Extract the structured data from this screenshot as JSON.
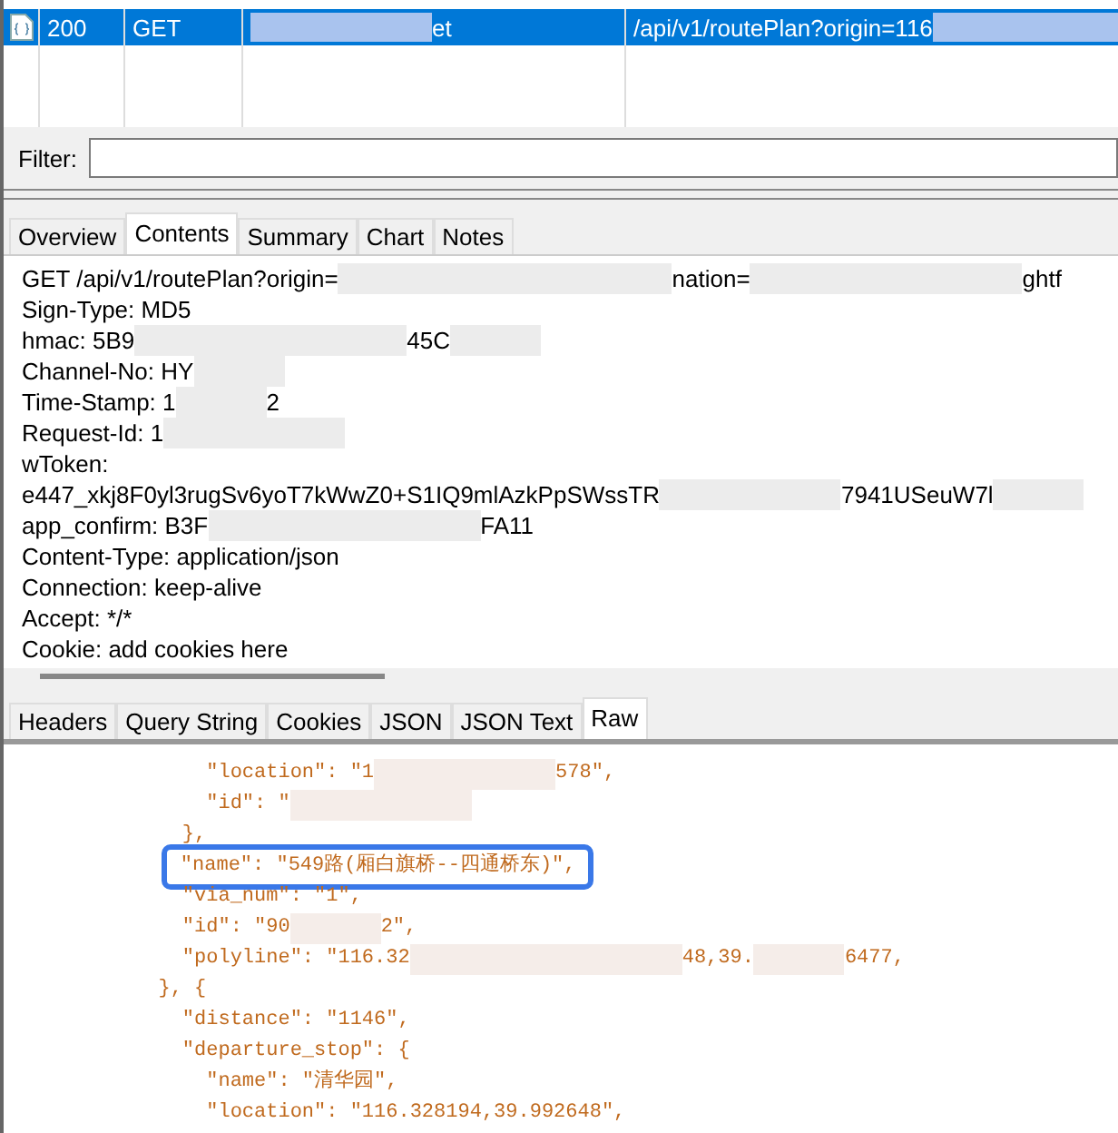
{
  "requests": [
    {
      "selected": true,
      "status": "200",
      "method": "GET",
      "host": [
        {
          "kind": "blur_medium"
        },
        {
          "kind": "text",
          "text": "et"
        }
      ],
      "path": [
        {
          "kind": "text",
          "text": "/api/v1/routePlan?origin=116"
        },
        {
          "kind": "blur_long"
        }
      ]
    }
  ],
  "filter": {
    "label": "Filter:"
  },
  "view_tabs": [
    {
      "label": "Overview",
      "selected": false
    },
    {
      "label": "Contents",
      "selected": true
    },
    {
      "label": "Summary",
      "selected": false
    },
    {
      "label": "Chart",
      "selected": false
    },
    {
      "label": "Notes",
      "selected": false
    }
  ],
  "request_lines": [
    [
      {
        "kind": "text",
        "text": "GET /api/v1/routePlan?origin="
      },
      {
        "kind": "blur_xlong"
      },
      {
        "kind": "text",
        "text": "nation="
      },
      {
        "kind": "blur_long"
      },
      {
        "kind": "text",
        "text": "ghtf"
      }
    ],
    [
      {
        "kind": "text",
        "text": "Sign-Type: MD5"
      }
    ],
    [
      {
        "kind": "text",
        "text": "hmac: 5B9"
      },
      {
        "kind": "blur_long"
      },
      {
        "kind": "text",
        "text": "45C"
      },
      {
        "kind": "blur_short"
      }
    ],
    [
      {
        "kind": "text",
        "text": "Channel-No: HY"
      },
      {
        "kind": "blur_short"
      }
    ],
    [
      {
        "kind": "text",
        "text": "Time-Stamp: 1"
      },
      {
        "kind": "blur_short"
      },
      {
        "kind": "text",
        "text": "2"
      }
    ],
    [
      {
        "kind": "text",
        "text": "Request-Id: 1"
      },
      {
        "kind": "blur_medium"
      }
    ],
    [
      {
        "kind": "text",
        "text": "wToken:"
      }
    ],
    [
      {
        "kind": "text",
        "text": "e447_xkj8F0yl3rugSv6yoT7kWwZ0+S1IQ9mlAzkPpSWssTR"
      },
      {
        "kind": "blur_medium"
      },
      {
        "kind": "text",
        "text": "7941USeuW7l"
      },
      {
        "kind": "blur_short"
      }
    ],
    [
      {
        "kind": "text",
        "text": "app_confirm: B3F"
      },
      {
        "kind": "blur_long"
      },
      {
        "kind": "text",
        "text": "FA11"
      }
    ],
    [
      {
        "kind": "text",
        "text": "Content-Type: application/json"
      }
    ],
    [
      {
        "kind": "text",
        "text": "Connection: keep-alive"
      }
    ],
    [
      {
        "kind": "text",
        "text": "Accept: */*"
      }
    ],
    [
      {
        "kind": "text",
        "text": "Cookie: add cookies here"
      }
    ]
  ],
  "body_tabs": [
    {
      "label": "Headers",
      "selected": false
    },
    {
      "label": "Query String",
      "selected": false
    },
    {
      "label": "Cookies",
      "selected": false
    },
    {
      "label": "JSON",
      "selected": false
    },
    {
      "label": "JSON Text",
      "selected": false
    },
    {
      "label": "Raw",
      "selected": true
    }
  ],
  "response_lines": [
    {
      "highlighted": false,
      "segments": [
        {
          "kind": "text",
          "text": "                \"location\": \"1"
        },
        {
          "kind": "blur_medium"
        },
        {
          "kind": "text",
          "text": "578\","
        }
      ]
    },
    {
      "highlighted": false,
      "segments": [
        {
          "kind": "text",
          "text": "                \"id\": \""
        },
        {
          "kind": "blur_medium"
        }
      ]
    },
    {
      "highlighted": false,
      "segments": [
        {
          "kind": "text",
          "text": "              },"
        }
      ]
    },
    {
      "highlighted": true,
      "segments": [
        {
          "kind": "text",
          "text": "              \"name\": \"549路(厢白旗桥--四通桥东)\","
        }
      ]
    },
    {
      "highlighted": false,
      "segments": [
        {
          "kind": "text",
          "text": "              \"via_num\": \"1\","
        }
      ]
    },
    {
      "highlighted": false,
      "segments": [
        {
          "kind": "text",
          "text": "              \"id\": \"90"
        },
        {
          "kind": "blur_short"
        },
        {
          "kind": "text",
          "text": "2\","
        }
      ]
    },
    {
      "highlighted": false,
      "segments": [
        {
          "kind": "text",
          "text": "              \"polyline\": \"116.32"
        },
        {
          "kind": "blur_long"
        },
        {
          "kind": "text",
          "text": "48,39."
        },
        {
          "kind": "blur_short"
        },
        {
          "kind": "text",
          "text": "6477,"
        }
      ]
    },
    {
      "highlighted": false,
      "segments": [
        {
          "kind": "text",
          "text": "            }, {"
        }
      ]
    },
    {
      "highlighted": false,
      "segments": [
        {
          "kind": "text",
          "text": "              \"distance\": \"1146\","
        }
      ]
    },
    {
      "highlighted": false,
      "segments": [
        {
          "kind": "text",
          "text": "              \"departure_stop\": {"
        }
      ]
    },
    {
      "highlighted": false,
      "segments": [
        {
          "kind": "text",
          "text": "                \"name\": \"清华园\","
        }
      ]
    },
    {
      "highlighted": false,
      "segments": [
        {
          "kind": "text",
          "text": "                \"location\": \"116.328194,39.992648\","
        }
      ]
    }
  ]
}
